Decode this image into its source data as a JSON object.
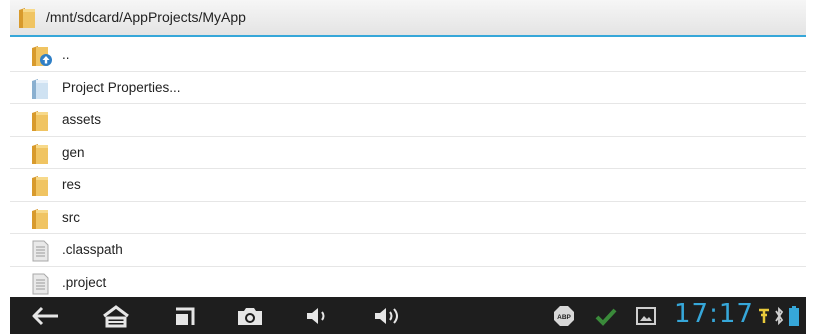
{
  "header": {
    "path": "/mnt/sdcard/AppProjects/MyApp",
    "icon": "folder-icon"
  },
  "files": [
    {
      "label": "..",
      "icon": "folder-up-icon"
    },
    {
      "label": "Project Properties...",
      "icon": "project-properties-folder-icon"
    },
    {
      "label": "assets",
      "icon": "folder-icon"
    },
    {
      "label": "gen",
      "icon": "folder-icon"
    },
    {
      "label": "res",
      "icon": "folder-icon"
    },
    {
      "label": "src",
      "icon": "folder-icon"
    },
    {
      "label": ".classpath",
      "icon": "file-icon"
    },
    {
      "label": ".project",
      "icon": "file-icon"
    }
  ],
  "navbar": {
    "buttons": [
      "back-icon",
      "home-icon",
      "recent-apps-icon",
      "camera-icon",
      "volume-down-icon",
      "volume-up-icon"
    ],
    "status_icons": [
      "adblock-abp-icon",
      "checkmark-icon",
      "gallery-icon",
      "usb-icon",
      "bluetooth-icon",
      "battery-icon"
    ],
    "time": "17:17",
    "abp_text": "ABP"
  },
  "colors": {
    "accent": "#36a7d9",
    "folder": "#e9b84f",
    "navbar_bg": "#1e1e1e",
    "check_green": "#3a8a3a"
  }
}
